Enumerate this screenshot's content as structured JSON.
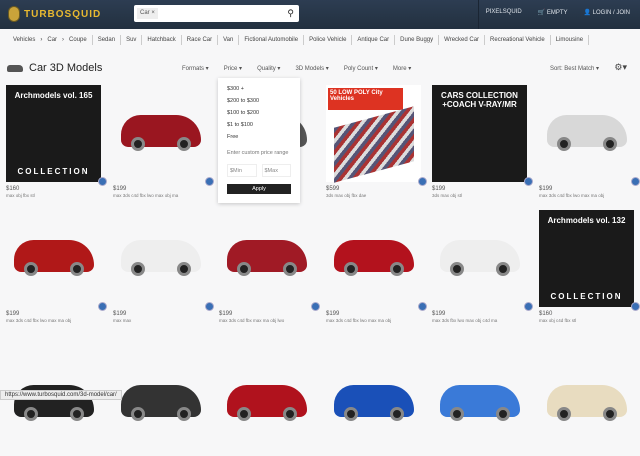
{
  "header": {
    "logo": "TurboSquid",
    "search_chip": "Car",
    "links": [
      "PIXELSQUID",
      "EMPTY",
      "LOGIN / JOIN"
    ]
  },
  "breadcrumb": [
    "Vehicles",
    "Car"
  ],
  "tags": [
    "Coupe",
    "Sedan",
    "Suv",
    "Hatchback",
    "Race Car",
    "Van",
    "Fictional Automobile",
    "Police Vehicle",
    "Antique Car",
    "Dune Buggy",
    "Wrecked Car",
    "Recreational Vehicle",
    "Limousine"
  ],
  "title": "Car 3D Models",
  "filters": [
    "Formats",
    "Price",
    "Quality",
    "3D Models",
    "Poly Count",
    "More"
  ],
  "sort": "Sort: Best Match",
  "price_dropdown": {
    "options": [
      "$300 +",
      "$200 to $300",
      "$100 to $200",
      "$1 to $100",
      "Free"
    ],
    "custom_label": "Enter custom price range",
    "min_placeholder": "$Min",
    "max_placeholder": "$Max",
    "apply": "Apply"
  },
  "products": [
    {
      "price": "$160",
      "formats": "max obj fbx stl",
      "label": "Archmodels vol. 165",
      "sub": "COLLECTION",
      "style": "dark"
    },
    {
      "price": "$199",
      "formats": "max 3ds c4d fbx lwo max obj ma",
      "color": "#9a1620"
    },
    {
      "price": "",
      "formats": "",
      "color": "#555"
    },
    {
      "price": "$599",
      "formats": "3ds max obj fbx dae",
      "label": "50 LOW POLY City Vehicles",
      "style": "lowpoly"
    },
    {
      "price": "$199",
      "formats": "3ds max obj stl",
      "label": "CARS COLLECTION +COACH V-RAY/MR",
      "style": "dark"
    },
    {
      "price": "$199",
      "formats": "max 3ds c4d fbx lwo max ma obj",
      "color": "#d8d8d8"
    },
    {
      "price": "$199",
      "formats": "max 3ds c4d fbx lwo max ma obj",
      "color": "#b01818"
    },
    {
      "price": "$199",
      "formats": "max max",
      "color": "#eeeeee"
    },
    {
      "price": "$199",
      "formats": "max 3ds c4d fbx max ma obj lwo",
      "color": "#a01a25"
    },
    {
      "price": "$199",
      "formats": "max 3ds c4d fbx lwo max ma obj",
      "color": "#b3121d"
    },
    {
      "price": "$199",
      "formats": "max 3ds fbx lwo max obj c4d ma",
      "color": "#eeeeee"
    },
    {
      "price": "$160",
      "formats": "max obj c4d fbx stl",
      "label": "Archmodels vol. 132",
      "sub": "COLLECTION",
      "style": "dark"
    },
    {
      "price": "",
      "formats": "",
      "color": "#222"
    },
    {
      "price": "",
      "formats": "",
      "color": "#333"
    },
    {
      "price": "",
      "formats": "",
      "color": "#b0121d"
    },
    {
      "price": "",
      "formats": "",
      "color": "#1a50b8"
    },
    {
      "price": "",
      "formats": "",
      "color": "#3a7ad8"
    },
    {
      "price": "",
      "formats": "",
      "color": "#e8dcc0"
    }
  ],
  "status_url": "https://www.turbosquid.com/3d-model/car/"
}
